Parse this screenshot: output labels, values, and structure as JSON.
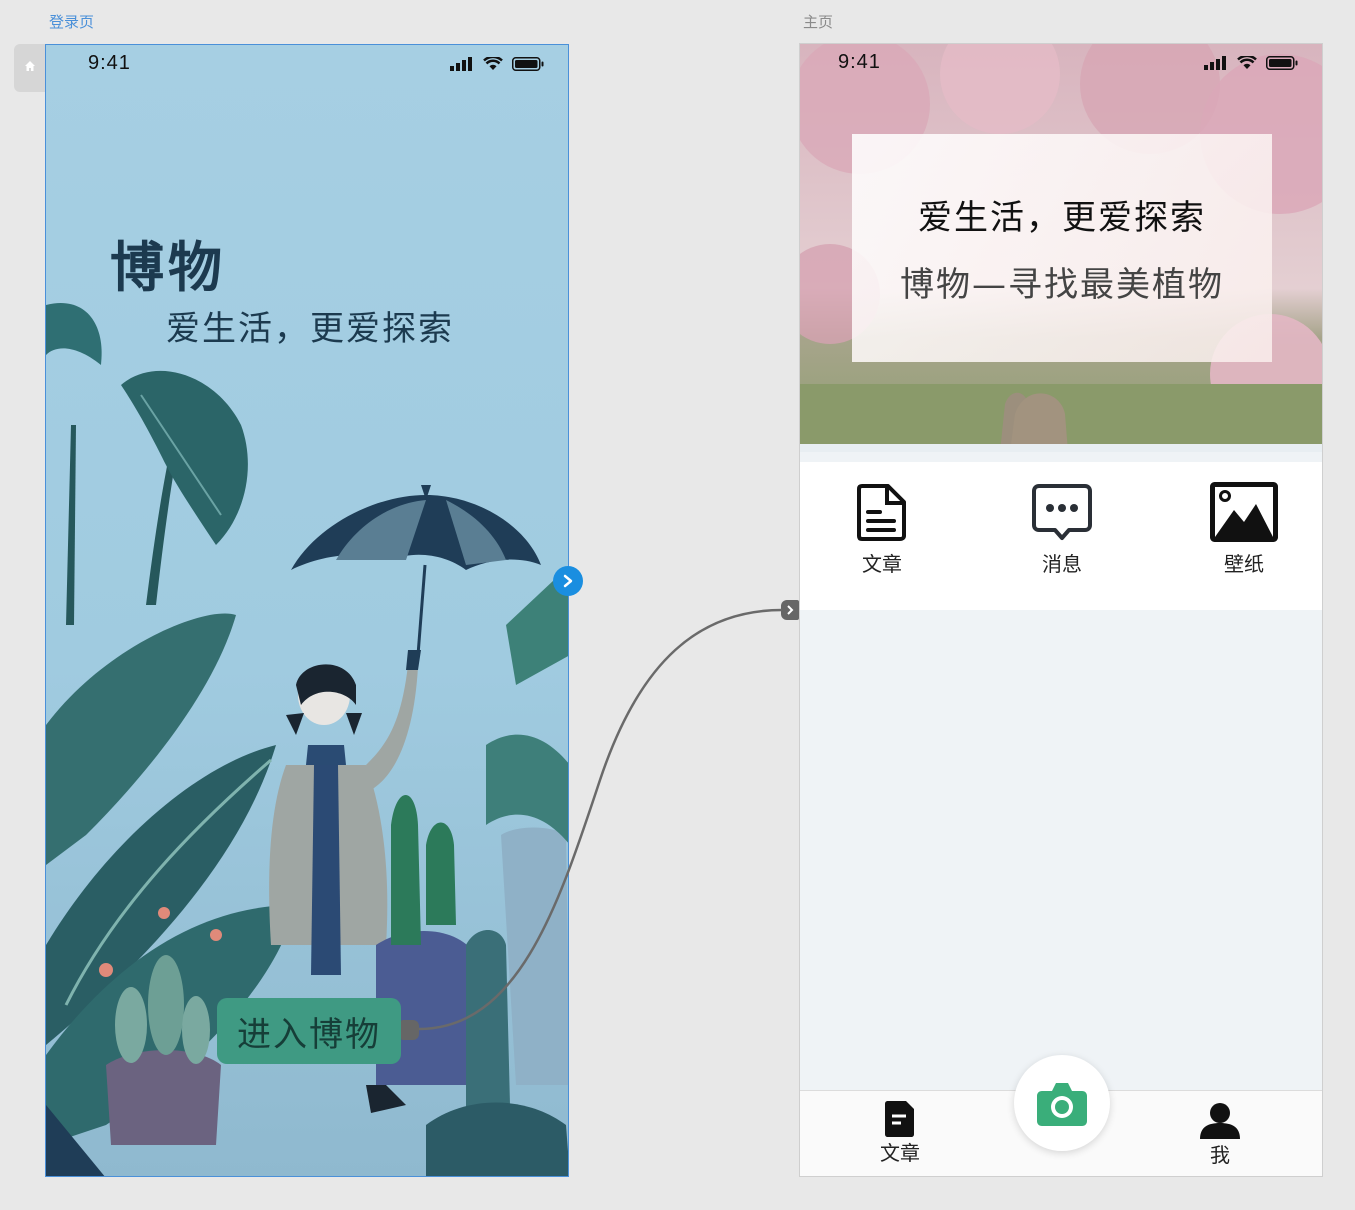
{
  "artboards": {
    "login": {
      "label": "登录页"
    },
    "home": {
      "label": "主页"
    }
  },
  "status_bar": {
    "time": "9:41"
  },
  "login": {
    "title": "博物",
    "slogan": "爱生活，更爱探索",
    "enter_button": "进入博物"
  },
  "home": {
    "hero": {
      "line1": "爱生活，更爱探索",
      "line2": "博物—寻找最美植物"
    },
    "quick_actions": [
      {
        "label": "文章",
        "icon": "document-icon"
      },
      {
        "label": "消息",
        "icon": "message-icon"
      },
      {
        "label": "壁纸",
        "icon": "image-icon"
      }
    ],
    "tabs": [
      {
        "label": "文章",
        "icon": "article-icon"
      },
      {
        "label": "",
        "icon": "camera-icon"
      },
      {
        "label": "我",
        "icon": "user-icon"
      }
    ]
  },
  "colors": {
    "login_bg": "#a6cfe3",
    "accent_green": "#3f9a83",
    "camera_green": "#3aae7a",
    "link_blue": "#1a8ee0",
    "selection_blue": "#4a90d9"
  }
}
